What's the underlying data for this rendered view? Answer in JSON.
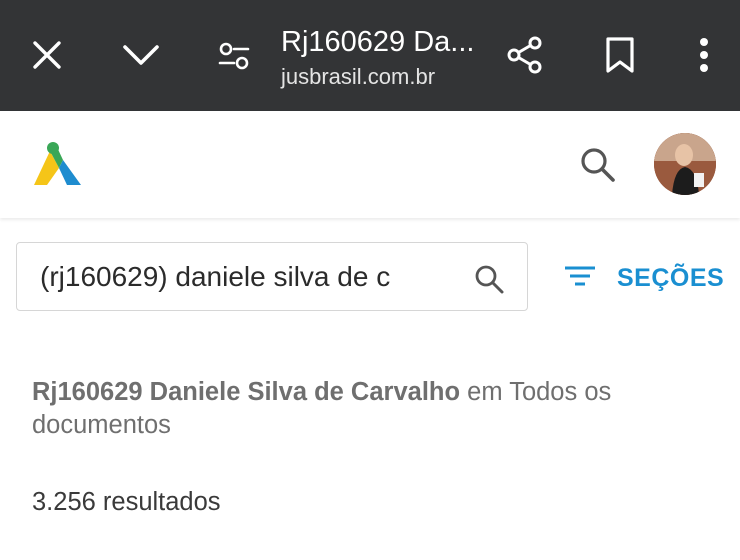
{
  "browser": {
    "title": "Rj160629 Da...",
    "url": "jusbrasil.com.br",
    "icons": [
      "close-icon",
      "chevron-down-icon",
      "site-settings-icon",
      "share-icon",
      "bookmark-icon",
      "more-vert-icon"
    ]
  },
  "header": {
    "logo": "jusbrasil-logo",
    "search_icon": "search-icon",
    "avatar": "user-avatar"
  },
  "search": {
    "value": "(rj160629) daniele silva de c"
  },
  "filters": {
    "sections_label": "SEÇÕES"
  },
  "results": {
    "query_bold": "Rj160629 Daniele Silva de Carvalho",
    "scope_text": " em Todos os documentos",
    "count_text": "3.256 resultados"
  },
  "colors": {
    "topbar": "#333436",
    "accent": "#1a8fd1",
    "logo_yellow": "#f5c518",
    "logo_green": "#3aa757",
    "logo_blue": "#1e8ccf"
  }
}
